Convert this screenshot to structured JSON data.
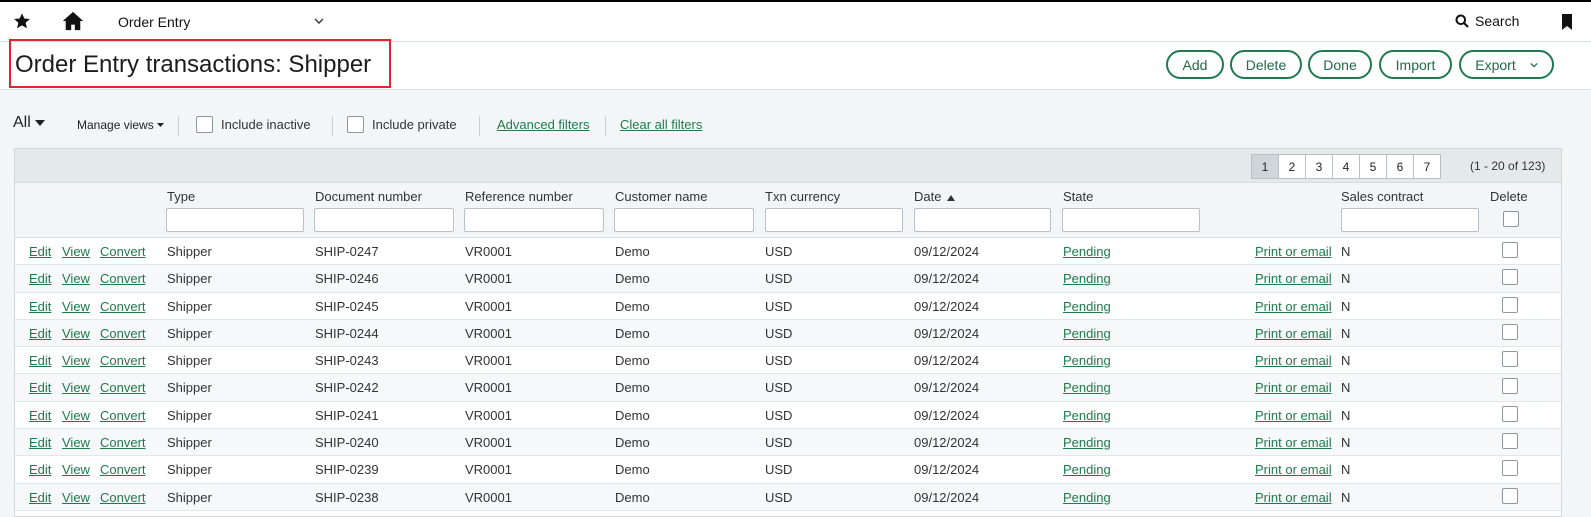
{
  "topbar": {
    "module": "Order Entry",
    "search_label": "Search",
    "icons": [
      "star-icon",
      "home-icon",
      "chevron-down-icon",
      "search-icon",
      "bookmark-icon"
    ]
  },
  "header": {
    "title": "Order Entry transactions: Shipper",
    "buttons": [
      "Add",
      "Delete",
      "Done",
      "Import",
      "Export"
    ]
  },
  "filters": {
    "view": "All",
    "manage_views": "Manage views",
    "include_inactive": "Include inactive",
    "include_private": "Include private",
    "advanced_filters": "Advanced filters",
    "clear_all_filters": "Clear all filters"
  },
  "pagination": {
    "pages": [
      "1",
      "2",
      "3",
      "4",
      "5",
      "6",
      "7"
    ],
    "current_page": "1",
    "range": "(1 - 20 of 123)"
  },
  "table": {
    "columns": [
      "Type",
      "Document number",
      "Reference number",
      "Customer name",
      "Txn currency",
      "Date",
      "State",
      "Sales contract",
      "Delete"
    ],
    "row_actions": [
      "Edit",
      "View",
      "Convert"
    ],
    "print_label": "Print or email",
    "sort_column": "Date",
    "rows": [
      {
        "type": "Shipper",
        "doc": "SHIP-0247",
        "ref": "VR0001",
        "customer": "Demo",
        "currency": "USD",
        "date": "09/12/2024",
        "state": "Pending",
        "contract": "N"
      },
      {
        "type": "Shipper",
        "doc": "SHIP-0246",
        "ref": "VR0001",
        "customer": "Demo",
        "currency": "USD",
        "date": "09/12/2024",
        "state": "Pending",
        "contract": "N"
      },
      {
        "type": "Shipper",
        "doc": "SHIP-0245",
        "ref": "VR0001",
        "customer": "Demo",
        "currency": "USD",
        "date": "09/12/2024",
        "state": "Pending",
        "contract": "N"
      },
      {
        "type": "Shipper",
        "doc": "SHIP-0244",
        "ref": "VR0001",
        "customer": "Demo",
        "currency": "USD",
        "date": "09/12/2024",
        "state": "Pending",
        "contract": "N"
      },
      {
        "type": "Shipper",
        "doc": "SHIP-0243",
        "ref": "VR0001",
        "customer": "Demo",
        "currency": "USD",
        "date": "09/12/2024",
        "state": "Pending",
        "contract": "N"
      },
      {
        "type": "Shipper",
        "doc": "SHIP-0242",
        "ref": "VR0001",
        "customer": "Demo",
        "currency": "USD",
        "date": "09/12/2024",
        "state": "Pending",
        "contract": "N"
      },
      {
        "type": "Shipper",
        "doc": "SHIP-0241",
        "ref": "VR0001",
        "customer": "Demo",
        "currency": "USD",
        "date": "09/12/2024",
        "state": "Pending",
        "contract": "N"
      },
      {
        "type": "Shipper",
        "doc": "SHIP-0240",
        "ref": "VR0001",
        "customer": "Demo",
        "currency": "USD",
        "date": "09/12/2024",
        "state": "Pending",
        "contract": "N"
      },
      {
        "type": "Shipper",
        "doc": "SHIP-0239",
        "ref": "VR0001",
        "customer": "Demo",
        "currency": "USD",
        "date": "09/12/2024",
        "state": "Pending",
        "contract": "N"
      },
      {
        "type": "Shipper",
        "doc": "SHIP-0238",
        "ref": "VR0001",
        "customer": "Demo",
        "currency": "USD",
        "date": "09/12/2024",
        "state": "Pending",
        "contract": "N"
      }
    ]
  },
  "colors": {
    "accent": "#1f7a4d",
    "highlight": "#e0262d"
  }
}
